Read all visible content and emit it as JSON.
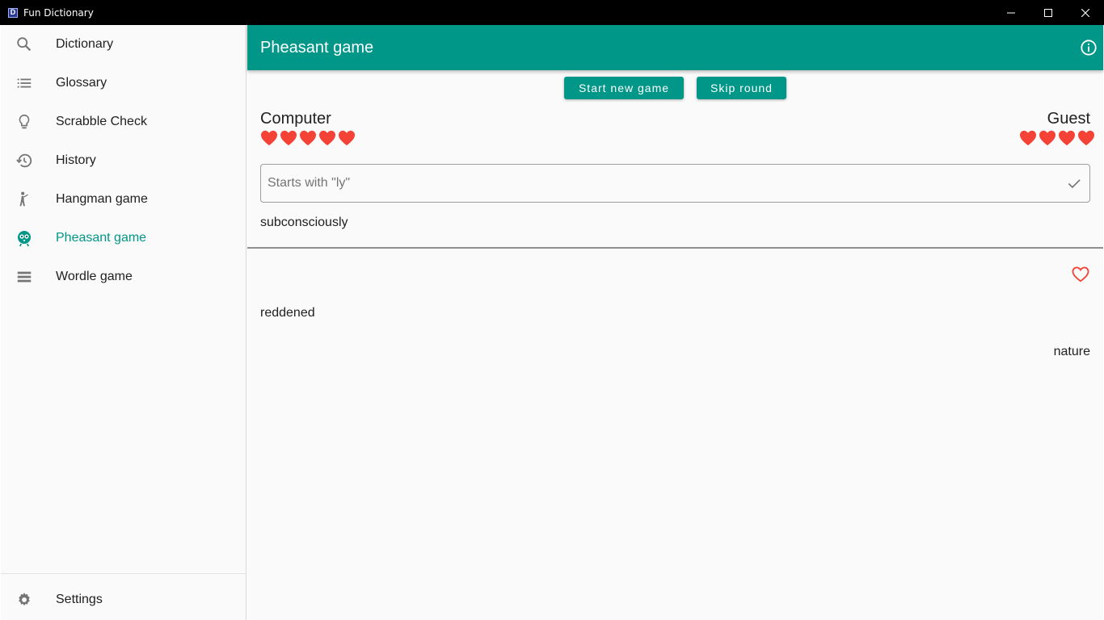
{
  "window": {
    "title": "Fun Dictionary",
    "app_icon_letter": "D"
  },
  "sidebar": {
    "items": [
      {
        "label": "Dictionary",
        "icon": "search-icon"
      },
      {
        "label": "Glossary",
        "icon": "list-icon"
      },
      {
        "label": "Scrabble Check",
        "icon": "lightbulb-icon"
      },
      {
        "label": "History",
        "icon": "history-icon"
      },
      {
        "label": "Hangman game",
        "icon": "hangman-icon"
      },
      {
        "label": "Pheasant game",
        "icon": "pheasant-icon",
        "active": true
      },
      {
        "label": "Wordle game",
        "icon": "menu-icon"
      }
    ],
    "settings": {
      "label": "Settings",
      "icon": "gear-icon"
    }
  },
  "appbar": {
    "title": "Pheasant game",
    "info_icon": "info-icon"
  },
  "actions": {
    "start_label": "Start new game",
    "skip_label": "Skip round"
  },
  "players": {
    "left": {
      "name": "Computer",
      "lives": 5
    },
    "right": {
      "name": "Guest",
      "lives": 4
    }
  },
  "input": {
    "placeholder": "Starts with \"ly\"",
    "value": ""
  },
  "current_word": "subconsciously",
  "history": {
    "left_word": "reddened",
    "right_word": "nature"
  },
  "colors": {
    "accent": "#009688",
    "heart": "#f44336"
  }
}
